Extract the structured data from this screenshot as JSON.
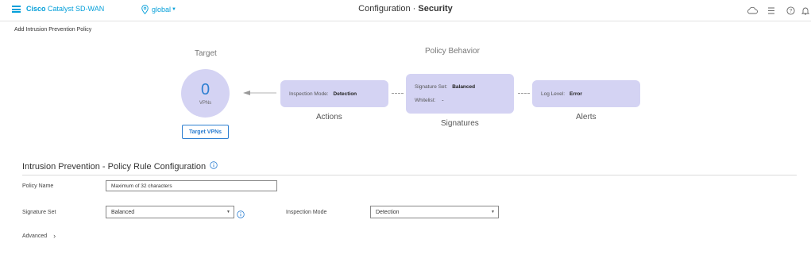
{
  "header": {
    "brand_prefix": "Cisco",
    "brand_suffix": "Catalyst SD-WAN",
    "scope": "global",
    "title_prefix": "Configuration · ",
    "title_main": "Security",
    "icons": [
      "hamburger-icon",
      "location-pin-icon",
      "cloud-icon",
      "list-icon",
      "help-icon",
      "bell-icon"
    ]
  },
  "subheading": "Add Intrusion Prevention Policy",
  "diagram": {
    "target_title": "Target",
    "behavior_title": "Policy Behavior",
    "target_count": "0",
    "target_unit": "VPNs",
    "target_button": "Target VPNs",
    "actions": {
      "key": "Inspection Mode:",
      "value": "Detection",
      "caption": "Actions"
    },
    "signatures": {
      "set_key": "Signature Set:",
      "set_value": "Balanced",
      "whitelist_key": "Whitelist:",
      "whitelist_value": "-",
      "caption": "Signatures"
    },
    "alerts": {
      "key": "Log Level:",
      "value": "Error",
      "caption": "Alerts"
    }
  },
  "config": {
    "section_title": "Intrusion Prevention - Policy Rule Configuration",
    "policy_name_label": "Policy Name",
    "policy_name_placeholder": "Maximum of 32 characters",
    "policy_name_value": "",
    "signature_set_label": "Signature Set",
    "signature_set_value": "Balanced",
    "inspection_mode_label": "Inspection Mode",
    "inspection_mode_value": "Detection",
    "advanced_label": "Advanced"
  },
  "colors": {
    "accent": "#049fd9",
    "link_blue": "#2e7fd1",
    "node_fill": "#d4d3f3"
  }
}
